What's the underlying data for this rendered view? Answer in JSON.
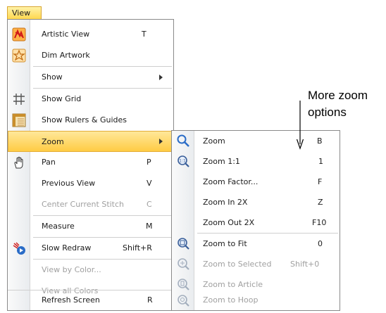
{
  "menubar": {
    "label": "View"
  },
  "view_menu": {
    "items": [
      {
        "label": "Artistic View",
        "shortcut": "T"
      },
      {
        "label": "Dim Artwork",
        "shortcut": ""
      },
      {
        "label": "Show",
        "shortcut": ""
      },
      {
        "label": "Show Grid",
        "shortcut": ""
      },
      {
        "label": "Show Rulers & Guides",
        "shortcut": ""
      },
      {
        "label": "Zoom",
        "shortcut": ""
      },
      {
        "label": "Pan",
        "shortcut": "P"
      },
      {
        "label": "Previous View",
        "shortcut": "V"
      },
      {
        "label": "Center Current Stitch",
        "shortcut": "C"
      },
      {
        "label": "Measure",
        "shortcut": "M"
      },
      {
        "label": "Slow Redraw",
        "shortcut": "Shift+R"
      },
      {
        "label": "View by Color...",
        "shortcut": ""
      },
      {
        "label": "View all Colors",
        "shortcut": ""
      },
      {
        "label": "Refresh Screen",
        "shortcut": "R"
      }
    ]
  },
  "zoom_menu": {
    "items": [
      {
        "label": "Zoom",
        "shortcut": "B"
      },
      {
        "label": "Zoom 1:1",
        "shortcut": "1"
      },
      {
        "label": "Zoom Factor...",
        "shortcut": "F"
      },
      {
        "label": "Zoom In 2X",
        "shortcut": "Z"
      },
      {
        "label": "Zoom Out 2X",
        "shortcut": "F10"
      },
      {
        "label": "Zoom to Fit",
        "shortcut": "0"
      },
      {
        "label": "Zoom to Selected",
        "shortcut": "Shift+0"
      },
      {
        "label": "Zoom to Article",
        "shortcut": ""
      },
      {
        "label": "Zoom to Hoop",
        "shortcut": ""
      }
    ]
  },
  "annotation": {
    "line1": "More zoom",
    "line2": "options"
  },
  "colors": {
    "highlight": "#ffcc44",
    "disabled_text": "#a0a0a0",
    "zoom_icon": "#2a6cc7"
  },
  "icons": [
    "artistic-view-icon",
    "dim-artwork-icon",
    "grid-icon",
    "rulers-icon",
    "pan-hand-icon",
    "slow-redraw-icon",
    "zoom-icon",
    "zoom-1-1-icon",
    "zoom-fit-icon",
    "zoom-selected-icon",
    "zoom-article-icon",
    "zoom-hoop-icon"
  ]
}
